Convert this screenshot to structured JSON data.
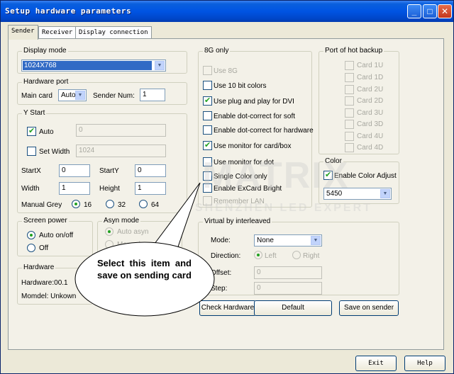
{
  "window": {
    "title": "Setup hardware parameters"
  },
  "tabs": [
    "Sender",
    "Receiver",
    "Display connection"
  ],
  "display_mode": {
    "legend": "Display mode",
    "value": "1024X768"
  },
  "hardware_port": {
    "legend": "Hardware port",
    "main_card_label": "Main card",
    "main_card_value": "Auto",
    "sender_num_label": "Sender Num:",
    "sender_num_value": "1"
  },
  "y_start": {
    "legend": "Y Start",
    "auto_label": "Auto",
    "auto_value": "0",
    "set_width_label": "Set Width",
    "set_width_value": "1024",
    "startx_label": "StartX",
    "startx_value": "0",
    "starty_label": "StartY",
    "starty_value": "0",
    "width_label": "Width",
    "width_value": "1",
    "height_label": "Height",
    "height_value": "1",
    "manual_grey_label": "Manual Grey",
    "grey_options": [
      "16",
      "32",
      "64"
    ]
  },
  "screen_power": {
    "legend": "Screen power",
    "options": [
      "Auto on/off",
      "Off"
    ]
  },
  "asyn_mode": {
    "legend": "Asyn mode",
    "options": [
      "Auto asyn",
      "Manual asyn"
    ]
  },
  "hardware": {
    "legend": "Hardware",
    "hardware_text": "Hardware:00.1",
    "model_text": "Momdel: Unkown"
  },
  "eight_g": {
    "legend": "8G only",
    "items": [
      "Use 8G",
      "Use 10 bit colors",
      "Use plug and play for DVI",
      "Enable dot-correct for soft",
      "Enable dot-correct for hardware",
      "Use monitor for card/box",
      "Use monitor for dot",
      "Single Color only",
      "Enable ExCard Bright",
      "Remember LAN"
    ]
  },
  "hot_backup": {
    "legend": "Port of hot backup",
    "items": [
      "Card 1U",
      "Card 1D",
      "Card 2U",
      "Card 2D",
      "Card 3U",
      "Card 3D",
      "Card 4U",
      "Card 4D"
    ]
  },
  "color": {
    "legend": "Color",
    "enable_label": "Enable Color Adjust",
    "value": "5450"
  },
  "virtual": {
    "legend": "Virtual by interleaved",
    "mode_label": "Mode:",
    "mode_value": "None",
    "direction_label": "Direction:",
    "left_label": "Left",
    "right_label": "Right",
    "offset_label": "Offset:",
    "offset_value": "0",
    "step_label": "Step:",
    "step_value": "0"
  },
  "buttons": {
    "check_hardware": "Check Hardware",
    "default": "Default",
    "save_on_sender": "Save on sender",
    "exit": "Exit",
    "help": "Help"
  },
  "callout": {
    "text": "Select this item and save on sending card"
  },
  "watermark": {
    "line1": "MATRIX",
    "line2": "SHENZHEN LED EXPERT"
  }
}
